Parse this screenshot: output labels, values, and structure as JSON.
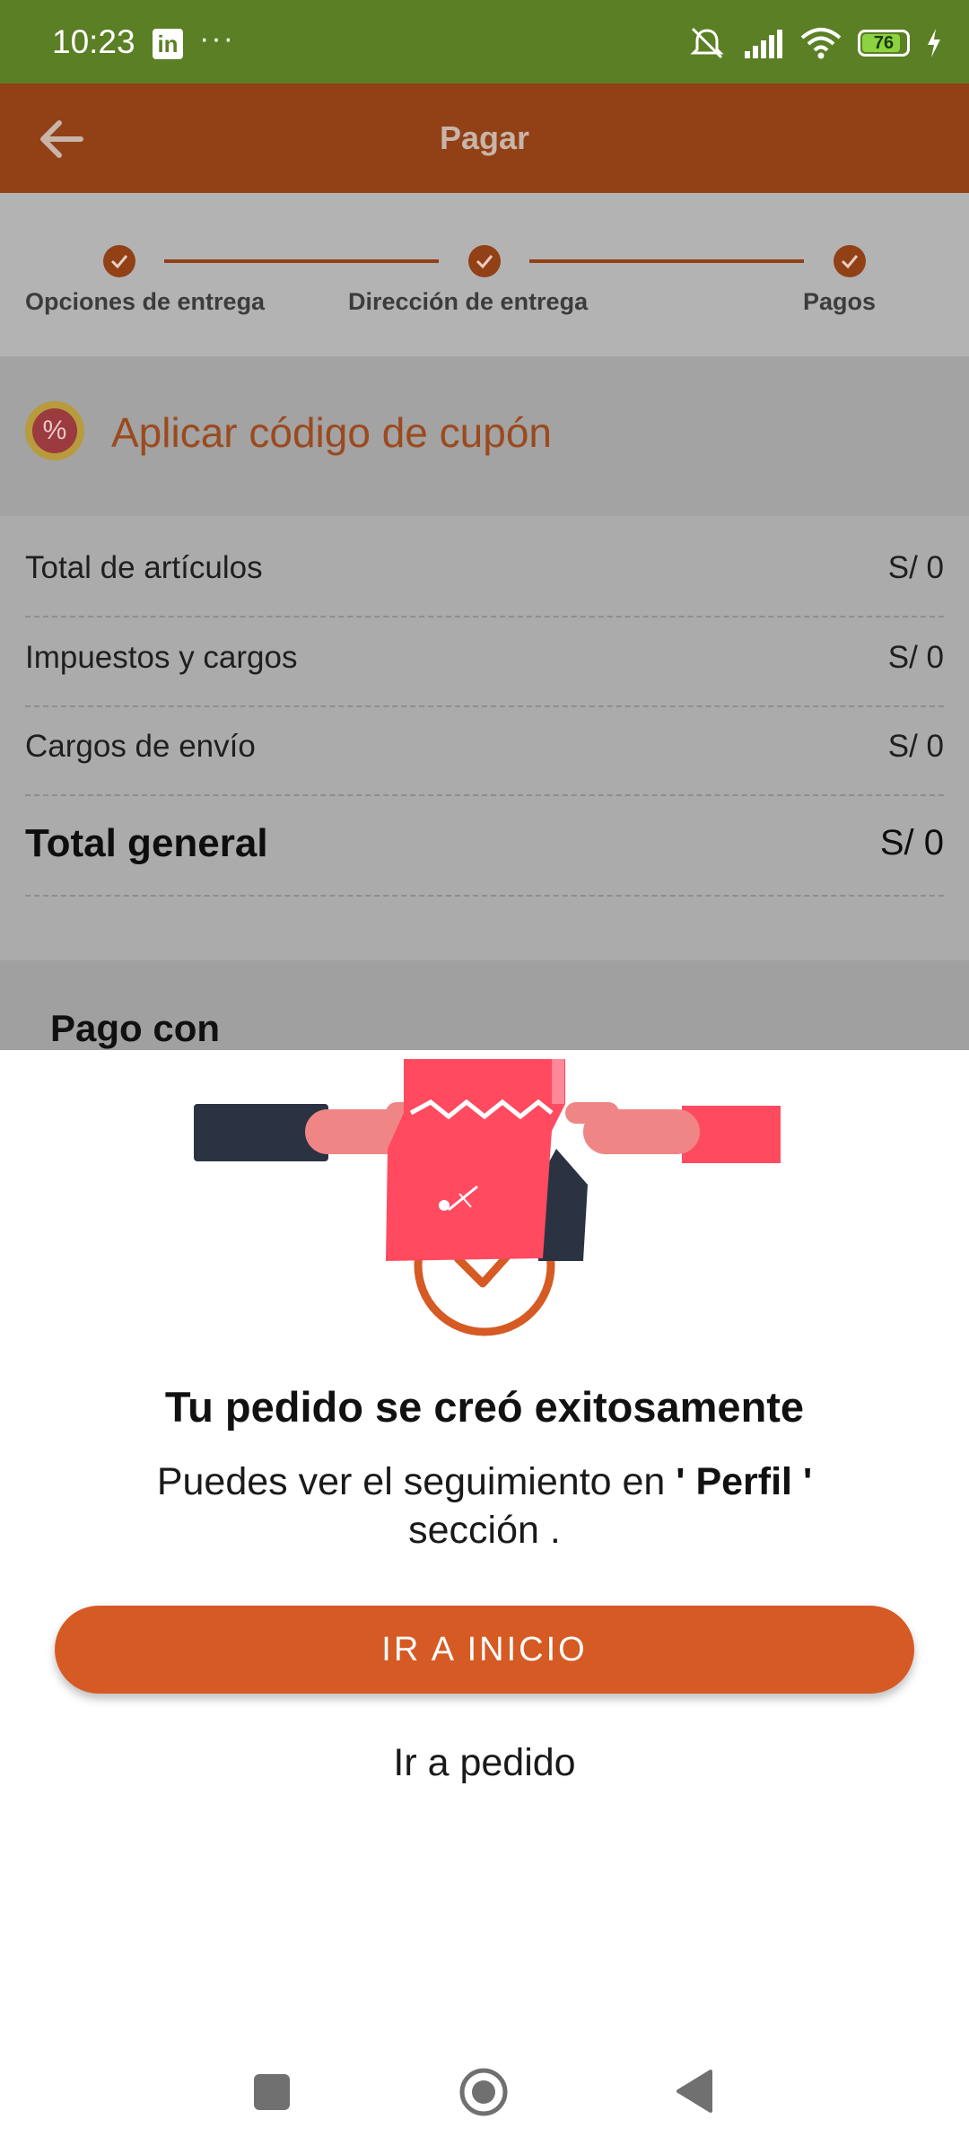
{
  "status_bar": {
    "time": "10:23",
    "linkedin_label": "in",
    "more": "···",
    "battery": "76"
  },
  "app_bar": {
    "title": "Pagar"
  },
  "stepper": {
    "steps": [
      {
        "label": "Opciones de entrega"
      },
      {
        "label": "Dirección de entrega"
      },
      {
        "label": "Pagos"
      }
    ],
    "accent_color": "#924016"
  },
  "coupon": {
    "label": "Aplicar código de cupón",
    "icon": "percent-badge-icon",
    "symbol": "%"
  },
  "summary": {
    "rows": [
      {
        "label": "Total de artículos",
        "value": "S/ 0"
      },
      {
        "label": "Impuestos y cargos",
        "value": "S/ 0"
      },
      {
        "label": "Cargos de envío",
        "value": "S/ 0"
      },
      {
        "label": "Total general",
        "value": "S/ 0"
      }
    ]
  },
  "payment": {
    "title": "Pago con"
  },
  "dialog": {
    "title": "Tu pedido se creó exitosamente",
    "body_prefix": "Puedes ver el seguimiento en ",
    "body_highlight": "' Perfil '",
    "body_suffix": "sección .",
    "primary_button": "IR A INICIO",
    "secondary_button": "Ir a pedido",
    "primary_color": "#d65a23"
  },
  "nav_bar": {
    "icons": [
      "recents-square-icon",
      "home-circle-icon",
      "back-triangle-icon"
    ]
  }
}
